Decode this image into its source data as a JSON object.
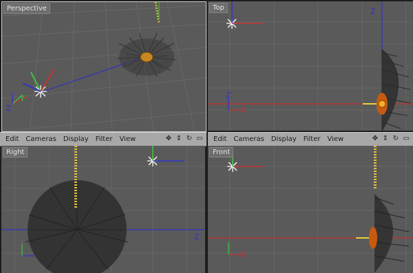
{
  "viewports": {
    "perspective": {
      "label": "Perspective"
    },
    "top": {
      "label": "Top",
      "axis_z": "Z",
      "axis_x": "X"
    },
    "right": {
      "label": "Right",
      "axis_z": "Z"
    },
    "front": {
      "label": "Front",
      "axis_x": "X"
    }
  },
  "axis_letters": {
    "x": "X",
    "y": "Y",
    "z": "Z"
  },
  "menubar": {
    "items": [
      "Edit",
      "Cameras",
      "Display",
      "Filter",
      "View"
    ]
  },
  "colors": {
    "viewport_bg": "#5a5a5a",
    "grid": "#676767",
    "axis_x": "#c83232",
    "axis_y": "#3cc83c",
    "axis_z": "#3232c8",
    "hair": "#2a2a2a",
    "bulb": "#d87a1a"
  }
}
